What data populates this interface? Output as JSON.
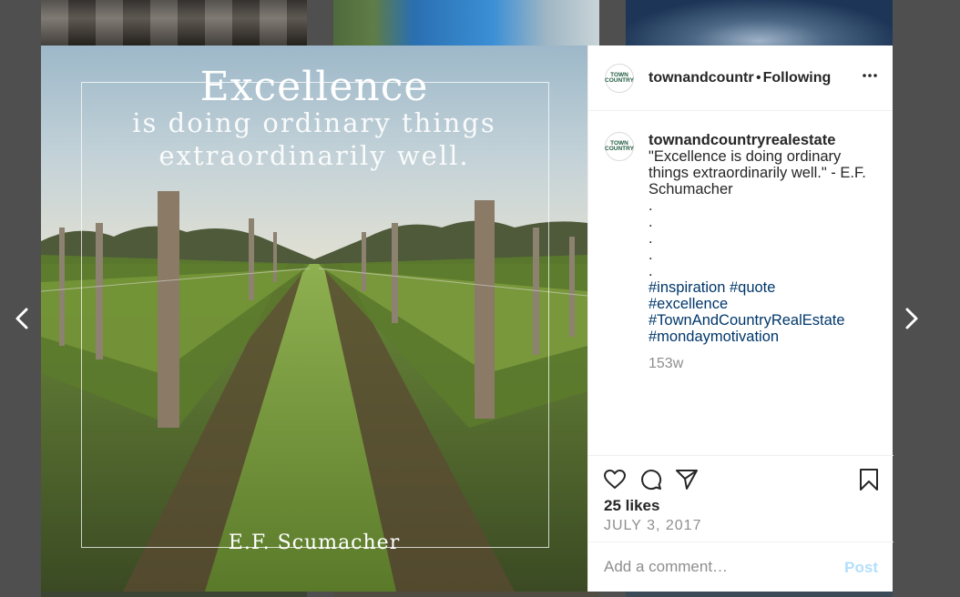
{
  "post": {
    "photo": {
      "quote_line1": "Excellence",
      "quote_line2": "is doing ordinary things",
      "quote_line3": "extraordinarily well.",
      "quote_author": "E.F. Scumacher"
    },
    "header": {
      "avatar_text": "TOWN COUNTRY",
      "username": "townandcountryrealestate",
      "separator": "•",
      "follow_state": "Following"
    },
    "caption": {
      "username": "townandcountryrealestate",
      "text": "\"Excellence is doing ordinary things extraordinarily well.\" - E.F. Schumacher",
      "dots": [
        ".",
        ".",
        ".",
        ".",
        "."
      ],
      "hashtags_line1": "#inspiration #quote",
      "hashtags_line2": "#excellence",
      "hashtags_line3": "#TownAndCountryRealEstate",
      "hashtags_line4": "#mondaymotivation",
      "time_ago": "153w"
    },
    "likes": "25 likes",
    "date": "JULY 3, 2017"
  },
  "comment": {
    "placeholder": "Add a comment…",
    "post_label": "Post"
  },
  "icons": {
    "like": "heart-icon",
    "comment": "comment-icon",
    "share": "share-icon",
    "save": "bookmark-icon",
    "more": "more-options-icon",
    "prev": "chevron-left-icon",
    "next": "chevron-right-icon"
  },
  "colors": {
    "hashtag": "#00376b",
    "post_disabled": "#b2dffc",
    "secondary_text": "#8e8e8e"
  }
}
